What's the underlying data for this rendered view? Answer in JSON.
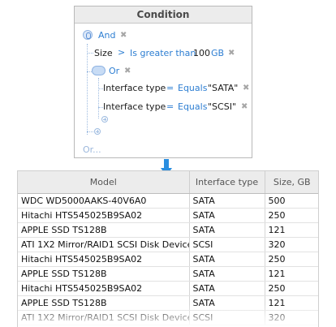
{
  "condition": {
    "title": "Condition",
    "root_group": {
      "operator": "And"
    },
    "size_row": {
      "field": "Size",
      "arrow": ">",
      "operator": "Is greater than",
      "value": "100",
      "unit": "GB"
    },
    "or_group": {
      "operator": "Or"
    },
    "iface_row1": {
      "field": "Interface type",
      "eq": "=",
      "operator": "Equals",
      "value": "\"SATA\""
    },
    "iface_row2": {
      "field": "Interface type",
      "eq": "=",
      "operator": "Equals",
      "value": "\"SCSI\""
    },
    "or_link": "Or...",
    "remove_glyph": "✖"
  },
  "table": {
    "columns": [
      "Model",
      "Interface type",
      "Size, GB"
    ],
    "rows": [
      [
        "WDC WD5000AAKS-40V6A0",
        "SATA",
        "500"
      ],
      [
        "Hitachi HTS545025B9SA02",
        "SATA",
        "250"
      ],
      [
        "APPLE SSD TS128B",
        "SATA",
        "121"
      ],
      [
        "ATI 1X2 Mirror/RAID1 SCSI Disk Device",
        "SCSI",
        "320"
      ],
      [
        "Hitachi HTS545025B9SA02",
        "SATA",
        "250"
      ],
      [
        "APPLE SSD TS128B",
        "SATA",
        "121"
      ],
      [
        "Hitachi HTS545025B9SA02",
        "SATA",
        "250"
      ],
      [
        "APPLE SSD TS128B",
        "SATA",
        "121"
      ],
      [
        "ATI 1X2 Mirror/RAID1 SCSI Disk Device",
        "SCSI",
        "320"
      ]
    ]
  },
  "colors": {
    "accent": "#2d7ed2",
    "arrow": "#2a8ee0"
  }
}
